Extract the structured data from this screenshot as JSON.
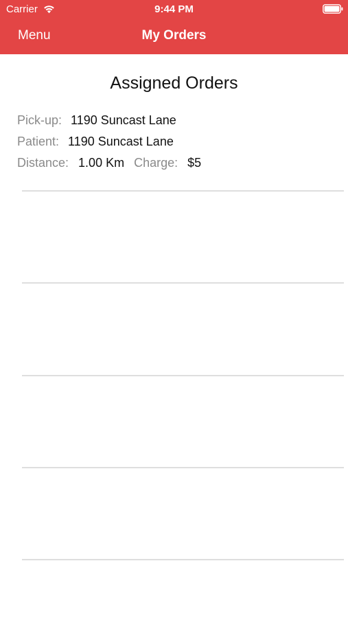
{
  "status_bar": {
    "carrier": "Carrier",
    "time": "9:44 PM",
    "icons": [
      "wifi-icon",
      "battery-icon"
    ]
  },
  "nav": {
    "menu_label": "Menu",
    "title": "My Orders"
  },
  "section": {
    "title": "Assigned Orders"
  },
  "order": {
    "pickup_label": "Pick-up:",
    "pickup_value": "1190 Suncast Lane",
    "patient_label": "Patient:",
    "patient_value": "1190 Suncast Lane",
    "distance_label": "Distance:",
    "distance_value": "1.00 Km",
    "charge_label": "Charge:",
    "charge_value": "$5"
  },
  "colors": {
    "header": "#E34545",
    "label": "#8a8a8a",
    "value": "#111111",
    "divider": "#dedede"
  }
}
